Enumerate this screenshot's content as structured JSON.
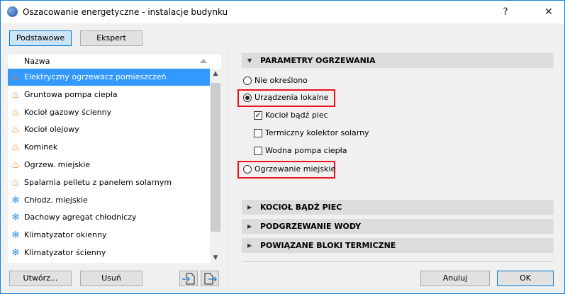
{
  "window": {
    "title": "Oszacowanie energetyczne - instalacje budynku",
    "help": "?",
    "close": "✕"
  },
  "modes": {
    "basic": "Podstawowe",
    "expert": "Ekspert"
  },
  "list": {
    "header": "Nazwa",
    "items": [
      {
        "label": "Elektryczny ogrzewacz pomieszczeń",
        "icon": "flame",
        "selected": true
      },
      {
        "label": "Gruntowa pompa ciepła",
        "icon": "flame"
      },
      {
        "label": "Kocioł gazowy ścienny",
        "icon": "flame"
      },
      {
        "label": "Kocioł olejowy",
        "icon": "flame"
      },
      {
        "label": "Kominek",
        "icon": "flame"
      },
      {
        "label": "Ogrzew. miejskie",
        "icon": "flame"
      },
      {
        "label": "Spalarnia pelletu z panelem solarnym",
        "icon": "flame"
      },
      {
        "label": "Chłodz. miejskie",
        "icon": "snowflake"
      },
      {
        "label": "Dachowy agregat chłodniczy",
        "icon": "snowflake"
      },
      {
        "label": "Klimatyzator okienny",
        "icon": "snowflake"
      },
      {
        "label": "Klimatyzator ścienny",
        "icon": "snowflake"
      }
    ]
  },
  "left_buttons": {
    "create": "Utwórz...",
    "delete": "Usuń"
  },
  "heating": {
    "title": "PARAMETRY OGRZEWANIA",
    "opt_none": "Nie określono",
    "opt_local": "Urządzenia lokalne",
    "chk_boiler": "Kocioł bądź piec",
    "chk_solar": "Termiczny kolektor solarny",
    "chk_pump": "Wodna pompa ciepła",
    "opt_district": "Ogrzewanie miejskie",
    "selected": "Urządzenia lokalne"
  },
  "sections": [
    "KOCIOŁ BĄDŹ PIEC",
    "PODGRZEWANIE WODY",
    "POWIĄZANE BLOKI TERMICZNE"
  ],
  "footer": {
    "cancel": "Anuluj",
    "ok": "OK"
  }
}
